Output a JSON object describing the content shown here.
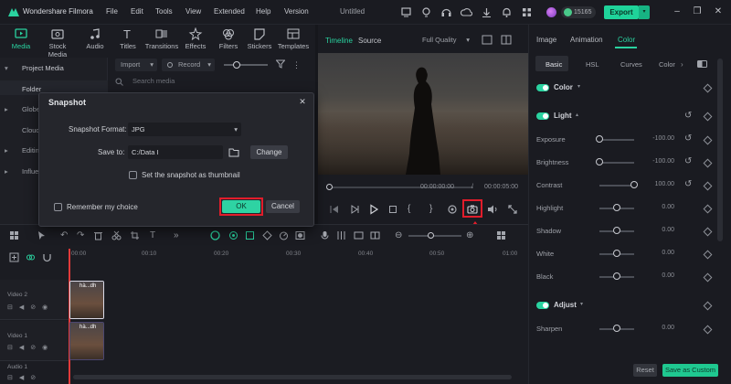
{
  "titlebar": {
    "app_name": "Wondershare Filmora",
    "menus": [
      "File",
      "Edit",
      "Tools",
      "View",
      "Extended",
      "Help",
      "Version"
    ],
    "doc_title": "Untitled",
    "credits": "15165",
    "export_label": "Export"
  },
  "media_tabs": [
    {
      "label": "Media",
      "icon": "media-icon"
    },
    {
      "label": "Stock Media",
      "icon": "stock-media-icon"
    },
    {
      "label": "Audio",
      "icon": "audio-icon"
    },
    {
      "label": "Titles",
      "icon": "titles-icon"
    },
    {
      "label": "Transitions",
      "icon": "transitions-icon"
    },
    {
      "label": "Effects",
      "icon": "effects-icon"
    },
    {
      "label": "Filters",
      "icon": "filters-icon"
    },
    {
      "label": "Stickers",
      "icon": "stickers-icon"
    },
    {
      "label": "Templates",
      "icon": "templates-icon"
    }
  ],
  "sidebar": {
    "project_media": "Project Media",
    "folder": "Folder",
    "partial_items": [
      "Globe",
      "Cloud",
      "Editing",
      "Influe"
    ]
  },
  "media_toolbar": {
    "import": "Import",
    "record": "Record",
    "search_placeholder": "Search media"
  },
  "preview": {
    "tab_timeline": "Timeline",
    "tab_source": "Source",
    "quality": "Full Quality",
    "time_current": "00:00:00:00",
    "time_sep": "/",
    "time_total": "00:00:05:00"
  },
  "right_panel": {
    "tabs": [
      "Image",
      "Animation",
      "Color"
    ],
    "subtabs": [
      "Basic",
      "HSL",
      "Curves",
      "Color"
    ],
    "sections": {
      "color": "Color",
      "light": "Light",
      "adjust": "Adjust"
    },
    "light_params": [
      {
        "label": "Exposure",
        "value": "-100.00",
        "level": 0
      },
      {
        "label": "Brightness",
        "value": "-100.00",
        "level": 0
      },
      {
        "label": "Contrast",
        "value": "100.00",
        "level": 1
      },
      {
        "label": "Highlight",
        "value": "0.00",
        "level": 0.5
      },
      {
        "label": "Shadow",
        "value": "0.00",
        "level": 0.5
      },
      {
        "label": "White",
        "value": "0.00",
        "level": 0.5
      },
      {
        "label": "Black",
        "value": "0.00",
        "level": 0.5
      }
    ],
    "adjust_params": [
      {
        "label": "Sharpen",
        "value": "0.00",
        "level": 0.5
      }
    ],
    "reset": "Reset",
    "save_custom": "Save as Custom"
  },
  "timeline": {
    "ruler": [
      "00:00",
      "00:10",
      "00:20",
      "00:30",
      "00:40",
      "00:50",
      "01:00"
    ],
    "track_video2": "Video 2",
    "track_video1": "Video 1",
    "track_audio1": "Audio 1",
    "clip_label": "hà...dh"
  },
  "dialog": {
    "title": "Snapshot",
    "format_label": "Snapshot Format:",
    "format_value": "JPG",
    "save_to_label": "Save to:",
    "save_to_value": "C:/Data I",
    "change": "Change",
    "thumbnail_label": "Set the snapshot as thumbnail",
    "remember_label": "Remember my choice",
    "ok": "OK",
    "cancel": "Cancel"
  },
  "colors": {
    "accent": "#2ad3a0",
    "highlight": "#e11d2b"
  }
}
